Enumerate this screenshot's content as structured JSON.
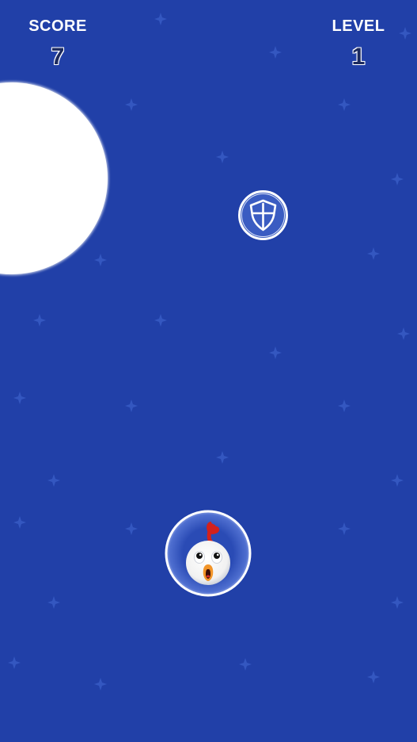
{
  "hud": {
    "score_label": "SCORE",
    "score_value": "7",
    "level_label": "LEVEL",
    "level_value": "1"
  },
  "colors": {
    "background": "#2140a8",
    "star": "#3457c0",
    "hud_text": "#ffffff",
    "hud_value": "#1c2a5e"
  },
  "objects": {
    "moon": "moon-obstacle",
    "powerup": "shield-icon",
    "player": "chicken-in-bubble"
  }
}
